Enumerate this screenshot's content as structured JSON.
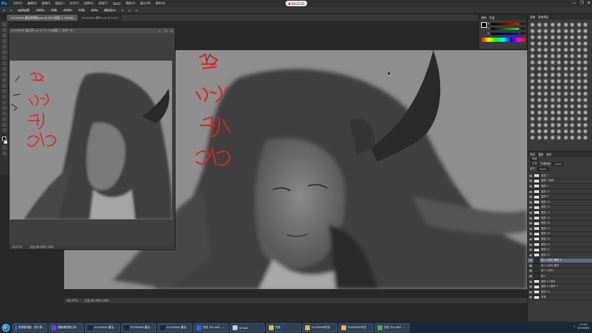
{
  "app": {
    "logo": "Ps"
  },
  "menus": [
    "文件(F)",
    "编辑(E)",
    "图像(I)",
    "图层(L)",
    "文字(Y)",
    "选择(S)",
    "滤镜(T)",
    "3D(D)",
    "视图(V)",
    "窗口(W)",
    "帮助(H)"
  ],
  "record_time": "04:21:25",
  "window_controls": {
    "minimize": "—",
    "restore": "❐",
    "close": "✕"
  },
  "options": {
    "mode_label": "连续连贯",
    "opacity_label": "不透",
    "flow_label": "平滑",
    "extra_label": "模拟压力",
    "values": [
      "100%",
      "100%",
      "10%"
    ]
  },
  "tabs": [
    {
      "label": "20190905-魔法师黑暗.psd @ 25%(图层 2, RGB/8)",
      "active": true
    },
    {
      "label": "20190905-最终.psd @ 100%",
      "active": false
    }
  ],
  "float_window": {
    "title": "20190905-魔法师.psd @ 16.7%(图层 1, 灰色 / 8) *",
    "ctrl_min": "—",
    "ctrl_max": "❐",
    "ctrl_close": "✕",
    "zoom": "16.67%",
    "doc_size": "文档:96.6M/1.90G"
  },
  "main_status": {
    "zoom": "66.67%",
    "doc_size": "文档:96.6M/1.90G"
  },
  "annotations": [
    "叠色",
    "主体?",
    "正片",
    "叠加"
  ],
  "color_panel": {
    "tabs": [
      "颜色",
      "色板"
    ],
    "sliders": [
      "R",
      "G",
      "B"
    ]
  },
  "brush_panel": {
    "tabs": [
      "画笔",
      "画笔预设"
    ]
  },
  "layers_panel": {
    "tabs": [
      "图层",
      "通道",
      "路径"
    ],
    "kind_label": "类型",
    "blend_mode": "正常",
    "opacity_label": "不透明度:",
    "opacity": "100%",
    "fill_label": "填充:",
    "fill": "100%",
    "layers": [
      "图层 7",
      "图层 1 副本",
      "图层 5",
      "图层 11",
      "图层 8",
      "图层 12",
      "图层 13",
      "图层 14",
      "图层 15",
      "图层 16",
      "图层 17",
      "图层 18",
      "图层 19",
      "图层 20",
      "图层 21",
      "图层 22",
      "组 1 (合并) 副本 2",
      "组 1 (合并) 副本",
      "组 1 (合并)",
      "组 1",
      "图层 23 副本",
      "图层 23 副本 2",
      "图层 24",
      "背景"
    ],
    "selected_index": 16
  },
  "taskbar": {
    "items": [
      {
        "label": "资源管理器 - 图片搜...",
        "color": "#3a7bd5"
      },
      {
        "label": "雷魅课程笔记本...",
        "color": "#7b3fd1"
      },
      {
        "label": "20190905-魔法...",
        "color": "#0f2a44"
      },
      {
        "label": "20190905-魔法...",
        "color": "#0f2a44"
      },
      {
        "label": "20190905-魔法...",
        "color": "#0f2a44"
      },
      {
        "label": "文档【20-60】-...",
        "color": "#2f6ad9"
      },
      {
        "label": "QClock",
        "color": "#cccccc"
      },
      {
        "label": "完成",
        "color": "#e6b84a"
      },
      {
        "label": "20190908作业",
        "color": "#e6b84a"
      },
      {
        "label": "20190905作业",
        "color": "#e6b84a"
      },
      {
        "label": "文档【20-60】-...",
        "color": "#4cae4c"
      }
    ],
    "time": "17:02",
    "date": "2019/9/9"
  }
}
